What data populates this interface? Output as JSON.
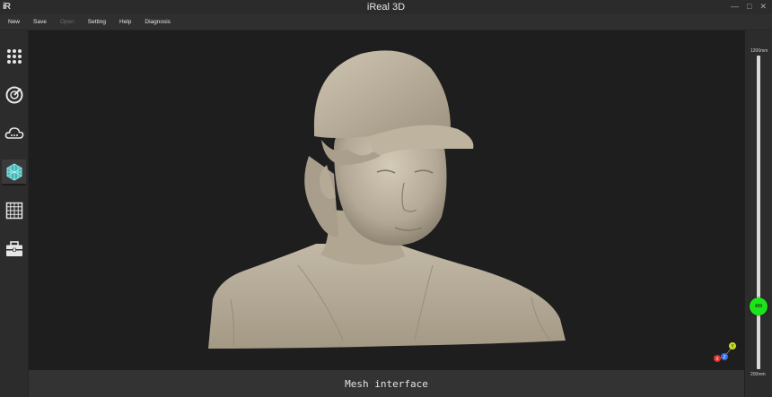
{
  "window": {
    "logo": "iR",
    "title": "iReal 3D",
    "controls": {
      "minimize": "—",
      "maximize": "□",
      "close": "✕"
    }
  },
  "menu": {
    "items": [
      {
        "label": "New",
        "enabled": true
      },
      {
        "label": "Save",
        "enabled": true
      },
      {
        "label": "Open",
        "enabled": false
      },
      {
        "label": "Setting",
        "enabled": true
      },
      {
        "label": "Help",
        "enabled": true
      },
      {
        "label": "Diagnosis",
        "enabled": true
      }
    ]
  },
  "toolbar": {
    "tools": [
      {
        "name": "dots-grid-icon",
        "active": false
      },
      {
        "name": "scan-radar-icon",
        "active": false
      },
      {
        "name": "point-cloud-icon",
        "active": false
      },
      {
        "name": "mesh-icon",
        "active": true
      },
      {
        "name": "texture-grid-icon",
        "active": false
      },
      {
        "name": "toolbox-icon",
        "active": false
      }
    ]
  },
  "status": {
    "text": "Mesh interface"
  },
  "depth_slider": {
    "max_label": "1200mm",
    "min_label": "200mm",
    "min": 200,
    "max": 1200,
    "value": 400,
    "value_label": "400",
    "thumb_color": "#1de31d"
  },
  "axes": {
    "x": "X",
    "y": "Y",
    "z": "Z",
    "x_color": "#e03030",
    "y_color": "#c8e020",
    "z_color": "#3a6ee0"
  },
  "model": {
    "color": "#b8ad9c"
  }
}
